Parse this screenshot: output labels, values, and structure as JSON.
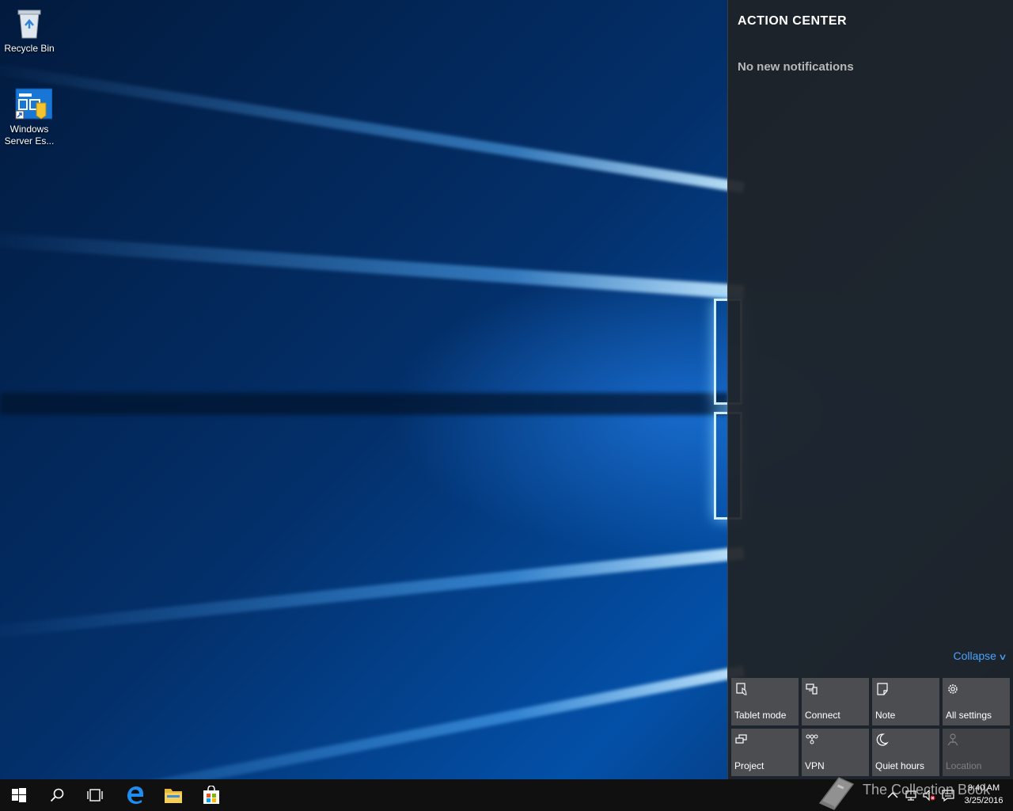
{
  "desktop": {
    "icons": [
      {
        "label": "Recycle Bin",
        "icon": "recycle-bin-icon"
      },
      {
        "label": "Windows Server Es...",
        "icon": "windows-server-essentials-icon"
      }
    ]
  },
  "action_center": {
    "title": "ACTION CENTER",
    "empty_message": "No new notifications",
    "collapse_label": "Collapse",
    "quick_actions": [
      {
        "label": "Tablet mode",
        "icon": "tablet-mode-icon",
        "enabled": true
      },
      {
        "label": "Connect",
        "icon": "connect-icon",
        "enabled": true
      },
      {
        "label": "Note",
        "icon": "note-icon",
        "enabled": true
      },
      {
        "label": "All settings",
        "icon": "gear-icon",
        "enabled": true
      },
      {
        "label": "Project",
        "icon": "project-icon",
        "enabled": true
      },
      {
        "label": "VPN",
        "icon": "vpn-icon",
        "enabled": true
      },
      {
        "label": "Quiet hours",
        "icon": "moon-icon",
        "enabled": true
      },
      {
        "label": "Location",
        "icon": "location-icon",
        "enabled": false
      }
    ],
    "colors": {
      "background": "#1f2226",
      "tile": "#4b4d51",
      "link": "#4aa3ff"
    }
  },
  "taskbar": {
    "buttons": [
      "start-button",
      "search-button",
      "task-view-button",
      "edge-button",
      "file-explorer-button",
      "store-button"
    ],
    "clock": {
      "time": "9:40 AM",
      "date": "3/25/2016"
    }
  },
  "watermark": {
    "text": "The Collection Book"
  }
}
